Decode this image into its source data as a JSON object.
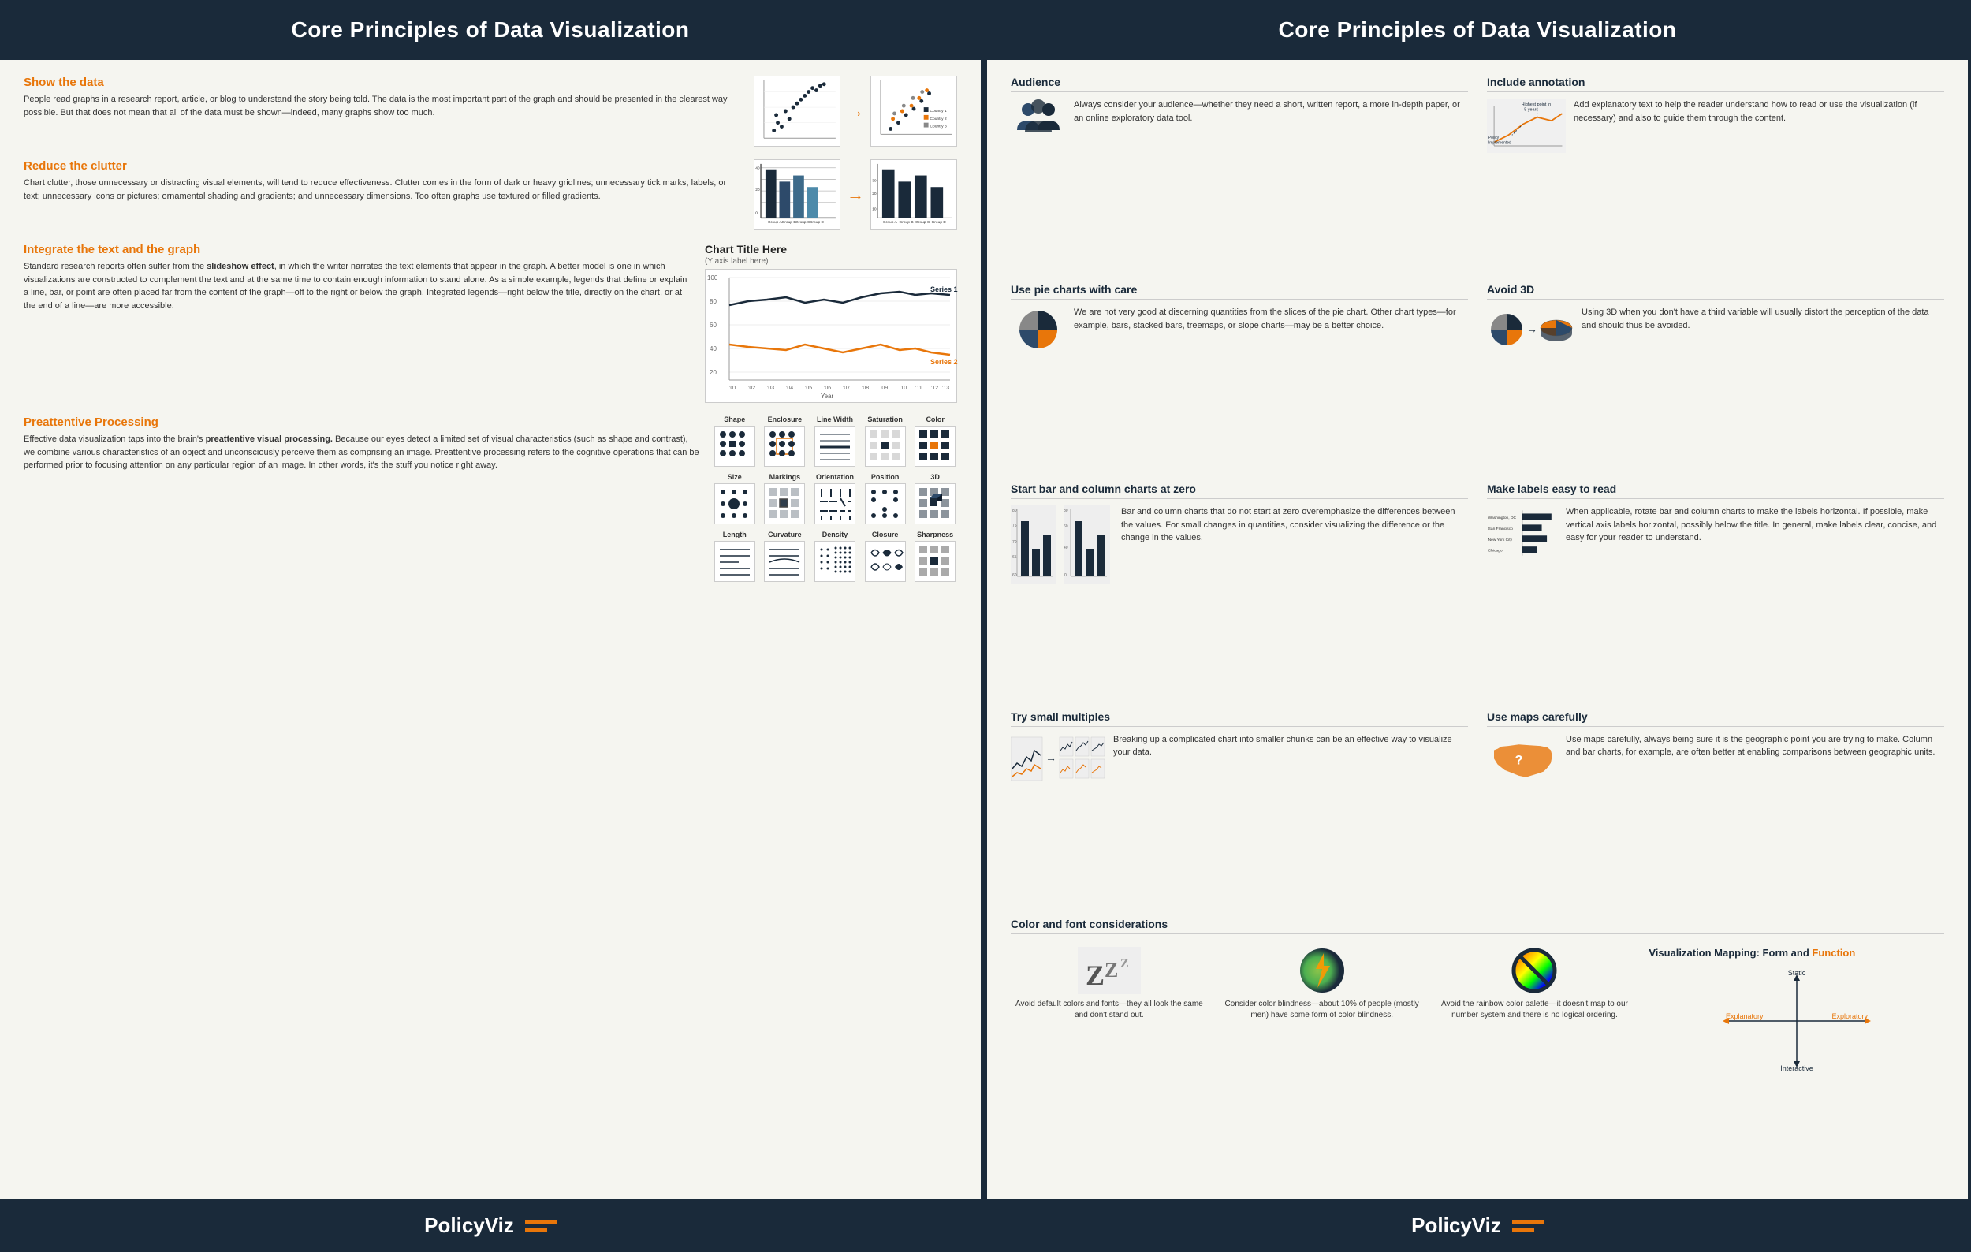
{
  "left": {
    "header": "Core Principles of Data Visualization",
    "sections": {
      "show_data": {
        "title": "Show the data",
        "body": "People read graphs in a research report, article, or blog to understand the story being told. The data is the most important part of the graph and should be presented in the clearest way possible. But that does not mean that all of the data must be shown—indeed, many graphs show too much."
      },
      "reduce_clutter": {
        "title": "Reduce the clutter",
        "body": "Chart clutter, those unnecessary or distracting visual elements, will tend to reduce effectiveness. Clutter comes in the form of dark or heavy gridlines; unnecessary tick marks, labels, or text; unnecessary icons or pictures; ornamental shading and gradients; and unnecessary dimensions. Too often graphs use textured or filled gradients."
      },
      "integrate_text": {
        "title": "Integrate the text and the graph",
        "body_part1": "Standard research reports often suffer from the ",
        "slideshow_effect": "slideshow effect",
        "body_part2": ", in which the writer narrates the text elements that appear in the graph. A better model is one in which visualizations are constructed to complement the text and at the same time to contain enough information to stand alone. As a simple example, legends that define or explain a line, bar, or point are often placed far from the content of the graph—off to the right or below the graph. Integrated legends—right below the title, directly on the chart, or at the end of a line—are more accessible.",
        "chart_title": "Chart Title Here",
        "chart_subtitle": "(Y axis label here)",
        "series1": "Series 1",
        "series2": "Series 2",
        "year_label": "Year"
      },
      "preattentive": {
        "title": "Preattentive Processing",
        "body_part1": "Effective data visualization taps into the brain's ",
        "highlight": "preattentive visual processing.",
        "body_part2": " Because our eyes detect a limited set of visual characteristics (such as shape and contrast), we combine various characteristics of an object and unconsciously perceive them as comprising an image. Preattentive processing refers to the cognitive operations that can be performed prior to focusing attention on any particular region of an image. In other words, it's the stuff you notice right away.",
        "categories": [
          "Shape",
          "Enclosure",
          "Line Width",
          "Saturation",
          "Color",
          "Size",
          "Markings",
          "Orientation",
          "Position",
          "3D",
          "Length",
          "Curvature",
          "Density",
          "Closure",
          "Sharpness"
        ]
      }
    },
    "footer_brand": "PolicyViz"
  },
  "right": {
    "header": "Core Principles of Data Visualization",
    "sections": {
      "audience": {
        "title": "Audience",
        "body": "Always consider your audience—whether they need a short, written report, a more in-depth paper, or an online exploratory data tool."
      },
      "annotation": {
        "title": "Include annotation",
        "body": "Add explanatory text to help the reader understand how to read or use the visualization (if necessary) and also to guide them through the content.",
        "chart_label1": "Highest point in 5 years",
        "chart_label2": "Policy Implemented"
      },
      "pie_charts": {
        "title": "Use pie charts with care",
        "body": "We are not very good at discerning quantities from the slices of the pie chart. Other chart types—for example, bars, stacked bars, treemaps, or slope charts—may be a better choice."
      },
      "avoid3d": {
        "title": "Avoid 3D",
        "body": "Using 3D when you don't have a third variable will usually distort the perception of the data and should thus be avoided."
      },
      "bar_zero": {
        "title": "Start bar and column charts at zero",
        "body": "Bar and column charts that do not start at zero overemphasize the differences between the values. For small changes in quantities, consider visualizing the difference or the change in the values."
      },
      "labels": {
        "title": "Make labels easy to read",
        "body": "When applicable, rotate bar and column charts to make the labels horizontal. If possible, make vertical axis labels horizontal, possibly below the title. In general, make labels clear, concise, and easy for your reader to understand.",
        "cities": [
          "Washington, DC",
          "San Francisco",
          "New York City",
          "Chicago"
        ]
      },
      "small_multiples": {
        "title": "Try small multiples",
        "body": "Breaking up a complicated chart into smaller chunks can be an effective way to visualize your data."
      },
      "maps": {
        "title": "Use maps carefully",
        "body": "Use maps carefully, always being sure it is the geographic point you are trying to make. Column and bar charts, for example, are often better at enabling comparisons between geographic units."
      },
      "color_font": {
        "title": "Color and font considerations",
        "items": [
          {
            "label": "Avoid default colors and fonts—they all look the same and don't stand out."
          },
          {
            "label": "Consider color blindness—about 10% of people (mostly men) have some form of color blindness."
          },
          {
            "label": "Avoid the rainbow color palette—it doesn't map to our number system and there is no logical ordering."
          }
        ]
      },
      "viz_mapping": {
        "title_part1": "Visualization Mapping: Form and ",
        "title_part2": "Function",
        "static": "Static",
        "interactive": "Interactive",
        "explanatory": "Explanatory",
        "exploratory": "Exploratory"
      }
    },
    "footer_brand": "PolicyViz"
  }
}
